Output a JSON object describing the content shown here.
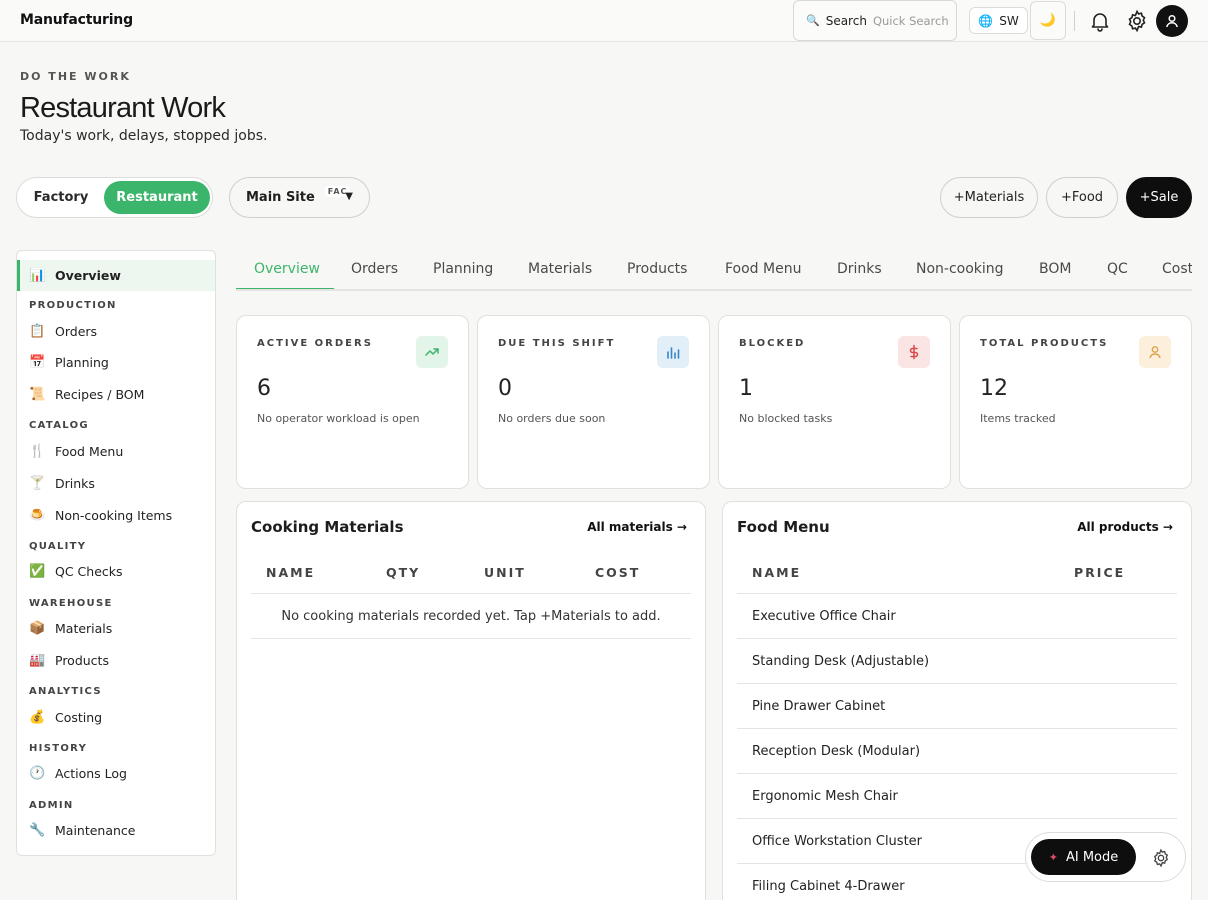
{
  "topbar": {
    "brand": "Manufacturing",
    "search_label": "Search",
    "search_placeholder": "Quick Search",
    "language": "SW"
  },
  "header": {
    "eyebrow": "DO THE WORK",
    "title": "Restaurant Work",
    "subtitle": "Today's work, delays, stopped jobs."
  },
  "mode": {
    "factory": "Factory",
    "restaurant": "Restaurant",
    "active": "Restaurant"
  },
  "site": {
    "name": "Main Site",
    "tag": "FAC"
  },
  "actions": {
    "materials": "+Materials",
    "food": "+Food",
    "sale": "+Sale"
  },
  "sidebar": {
    "items": [
      {
        "icon": "📊",
        "label": "Overview"
      },
      {
        "icon": "📋",
        "label": "Orders"
      },
      {
        "icon": "📅",
        "label": "Planning"
      },
      {
        "icon": "📜",
        "label": "Recipes / BOM"
      },
      {
        "icon": "🍴",
        "label": "Food Menu"
      },
      {
        "icon": "🍸",
        "label": "Drinks"
      },
      {
        "icon": "🍮",
        "label": "Non-cooking Items"
      },
      {
        "icon": "✅",
        "label": "QC Checks"
      },
      {
        "icon": "📦",
        "label": "Materials"
      },
      {
        "icon": "🏭",
        "label": "Products"
      },
      {
        "icon": "💰",
        "label": "Costing"
      },
      {
        "icon": "🕐",
        "label": "Actions Log"
      },
      {
        "icon": "🔧",
        "label": "Maintenance"
      }
    ],
    "groups": {
      "production": "PRODUCTION",
      "catalog": "CATALOG",
      "quality": "QUALITY",
      "warehouse": "WAREHOUSE",
      "analytics": "ANALYTICS",
      "history": "HISTORY",
      "admin": "ADMIN"
    }
  },
  "tabs": [
    "Overview",
    "Orders",
    "Planning",
    "Materials",
    "Products",
    "Food Menu",
    "Drinks",
    "Non-cooking",
    "BOM",
    "QC",
    "Cost"
  ],
  "kpis": [
    {
      "label": "ACTIVE ORDERS",
      "value": "6",
      "note": "No operator workload is open",
      "icon": "trend-up-icon",
      "color": "#3bb56b",
      "bg": "#e3f4e9"
    },
    {
      "label": "DUE THIS SHIFT",
      "value": "0",
      "note": "No orders due soon",
      "icon": "bar-chart-icon",
      "color": "#3a86c6",
      "bg": "#e2eef8"
    },
    {
      "label": "BLOCKED",
      "value": "1",
      "note": "No blocked tasks",
      "icon": "dollar-icon",
      "color": "#d94a4a",
      "bg": "#fbe4e4"
    },
    {
      "label": "TOTAL PRODUCTS",
      "value": "12",
      "note": "Items tracked",
      "icon": "user-icon",
      "color": "#e0a24a",
      "bg": "#fcefdc"
    }
  ],
  "cooking_materials": {
    "title": "Cooking Materials",
    "link": "All materials →",
    "columns": [
      "NAME",
      "QTY",
      "UNIT",
      "COST"
    ],
    "empty": "No cooking materials recorded yet. Tap +Materials to add."
  },
  "food_menu": {
    "title": "Food Menu",
    "link": "All products →",
    "columns": [
      "NAME",
      "PRICE"
    ],
    "rows": [
      "Executive Office Chair",
      "Standing Desk (Adjustable)",
      "Pine Drawer Cabinet",
      "Reception Desk (Modular)",
      "Ergonomic Mesh Chair",
      "Office Workstation Cluster",
      "Filing Cabinet 4-Drawer"
    ]
  },
  "ai": {
    "label": "AI Mode"
  }
}
